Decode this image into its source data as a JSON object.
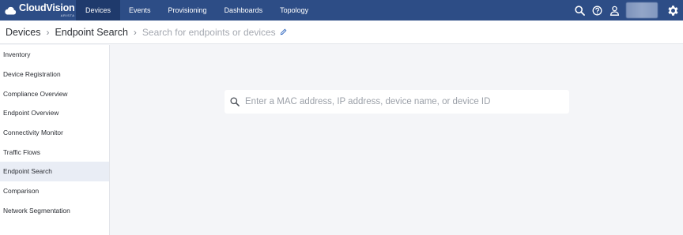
{
  "brand": {
    "name": "CloudVision",
    "sub": "ARISTA",
    "color": "#2d4d86"
  },
  "nav": {
    "items": [
      {
        "label": "Devices",
        "active": true
      },
      {
        "label": "Events"
      },
      {
        "label": "Provisioning"
      },
      {
        "label": "Dashboards"
      },
      {
        "label": "Topology"
      }
    ]
  },
  "top_icons": [
    "search-icon",
    "help-icon",
    "user-icon",
    "settings-gear-icon"
  ],
  "breadcrumb": {
    "root": "Devices",
    "current": "Endpoint Search",
    "edit_placeholder": "Search for endpoints or devices"
  },
  "sidebar": {
    "items": [
      {
        "label": "Inventory"
      },
      {
        "label": "Device Registration"
      },
      {
        "label": "Compliance Overview"
      },
      {
        "label": "Endpoint Overview"
      },
      {
        "label": "Connectivity Monitor"
      },
      {
        "label": "Traffic Flows"
      },
      {
        "label": "Endpoint Search",
        "active": true
      },
      {
        "label": "Comparison"
      },
      {
        "label": "Network Segmentation"
      }
    ]
  },
  "search": {
    "placeholder": "Enter a MAC address, IP address, device name, or device ID",
    "value": ""
  }
}
